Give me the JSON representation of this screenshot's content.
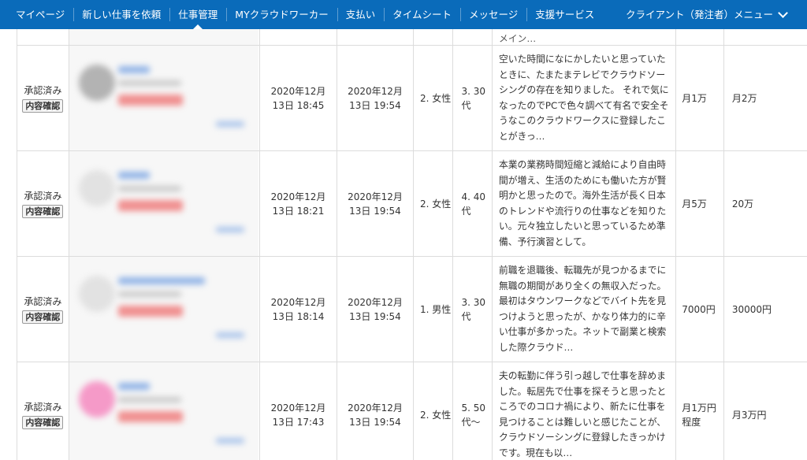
{
  "nav": {
    "items": [
      {
        "label": "マイページ"
      },
      {
        "label": "新しい仕事を依頼"
      },
      {
        "label": "仕事管理",
        "active": true
      },
      {
        "label": "MYクラウドワーカー"
      },
      {
        "label": "支払い"
      },
      {
        "label": "タイムシート"
      },
      {
        "label": "メッセージ"
      },
      {
        "label": "支援サービス"
      }
    ],
    "client_menu": "クライアント（発注者）メニュー"
  },
  "top_row": {
    "reason_tail": "メイン…"
  },
  "rows": [
    {
      "status": "承認済み",
      "button": "内容確認",
      "date1": [
        "2020年12月",
        "13日 18:45"
      ],
      "date2": [
        "2020年12月",
        "13日 19:54"
      ],
      "gender": "2. 女性",
      "age": "3. 30代",
      "reason": "空いた時間になにかしたいと思っていたときに、たまたまテレビでクラウドソーシングの存在を知りました。 それで気になったのでPCで色々調べて有名で安全そうなこのクラウドワークスに登録したことがきっ…",
      "current": "月1万",
      "goal": "月2万",
      "avatar_color": "#b3b3b3"
    },
    {
      "status": "承認済み",
      "button": "内容確認",
      "date1": [
        "2020年12月",
        "13日 18:21"
      ],
      "date2": [
        "2020年12月",
        "13日 19:54"
      ],
      "gender": "2. 女性",
      "age": "4. 40代",
      "reason": "本業の業務時間短縮と減給により自由時間が増え、生活のためにも働いた方が賢明かと思ったので。海外生活が長く日本のトレンドや流行りの仕事などを知りたい。元々独立したいと思っているため準備、予行演習として。",
      "current": "月5万",
      "goal": "20万",
      "avatar_color": "#e2e2e2"
    },
    {
      "status": "承認済み",
      "button": "内容確認",
      "date1": [
        "2020年12月",
        "13日 18:14"
      ],
      "date2": [
        "2020年12月",
        "13日 19:54"
      ],
      "gender": "1. 男性",
      "age": "3. 30代",
      "reason": "前職を退職後、転職先が見つかるまでに無職の期間があり全くの無収入だった。最初はタウンワークなどでバイト先を見つけようと思ったが、かなり体力的に辛い仕事が多かった。ネットで副業と検索した際クラウド…",
      "current": "7000円",
      "goal": "30000円",
      "avatar_color": "#e2e2e2"
    },
    {
      "status": "承認済み",
      "button": "内容確認",
      "date1": [
        "2020年12月",
        "13日 17:43"
      ],
      "date2": [
        "2020年12月",
        "13日 19:54"
      ],
      "gender": "2. 女性",
      "age": "5. 50代〜",
      "reason": "夫の転勤に伴う引っ越しで仕事を辞めました。転居先で仕事を探そうと思ったところでのコロナ禍により、新たに仕事を見つけることは難しいと感じたことが、クラウドソーシングに登録したきっかけです。現在も以…",
      "current": "月1万円程度",
      "goal": "月3万円",
      "avatar_color": "#f59ac8"
    }
  ]
}
